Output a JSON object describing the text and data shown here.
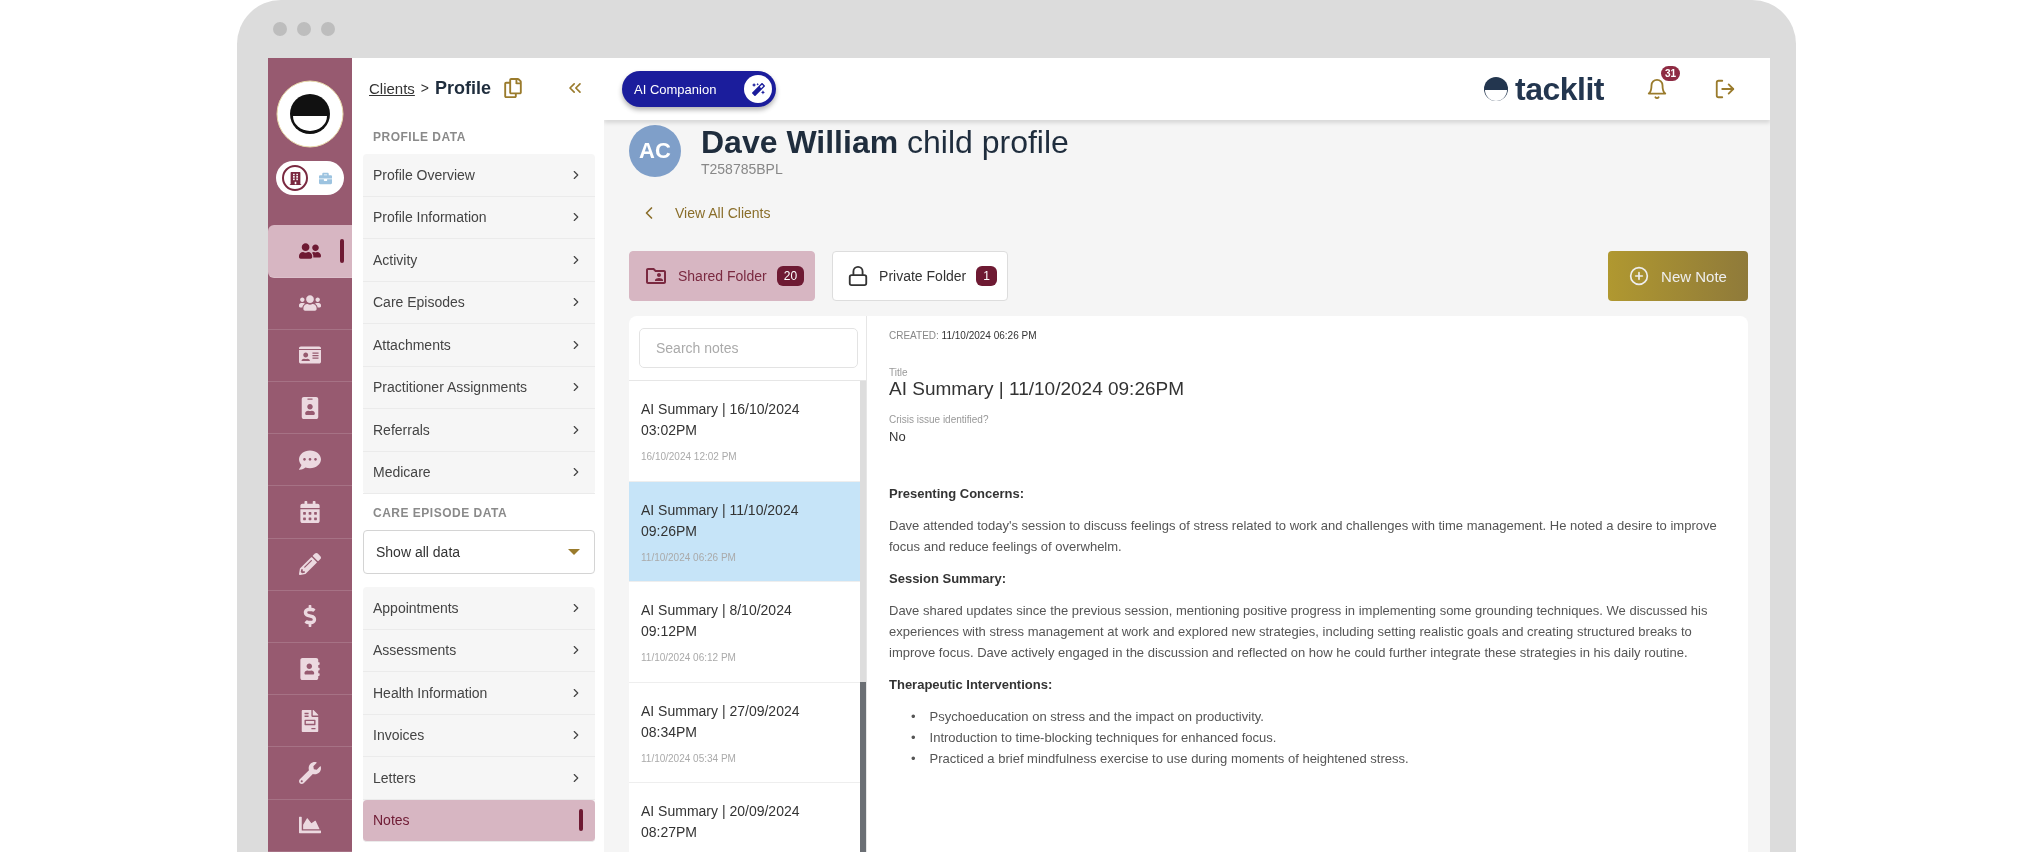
{
  "rail": {
    "items": [
      {
        "selected": true
      },
      {
        "selected": false
      },
      {
        "selected": false
      },
      {
        "selected": false
      },
      {
        "selected": false
      },
      {
        "selected": false
      },
      {
        "selected": false
      },
      {
        "selected": false
      },
      {
        "selected": false
      },
      {
        "selected": false
      },
      {
        "selected": false
      },
      {
        "selected": false
      }
    ],
    "mode_toggle": [
      {
        "selected": true
      },
      {
        "selected": false
      }
    ]
  },
  "sidebar": {
    "breadcrumb_link": "Clients",
    "breadcrumb_separator": ">",
    "breadcrumb_current": "Profile",
    "sections": [
      {
        "label": "PROFILE DATA",
        "items": [
          {
            "label": "Profile Overview",
            "selected": false
          },
          {
            "label": "Profile Information",
            "selected": false
          },
          {
            "label": "Activity",
            "selected": false
          },
          {
            "label": "Care Episodes",
            "selected": false
          },
          {
            "label": "Attachments",
            "selected": false
          },
          {
            "label": "Practitioner Assignments",
            "selected": false
          },
          {
            "label": "Referrals",
            "selected": false
          },
          {
            "label": "Medicare",
            "selected": false
          }
        ]
      },
      {
        "label": "CARE EPISODE DATA",
        "dropdown": "Show all data",
        "items": [
          {
            "label": "Appointments",
            "selected": false
          },
          {
            "label": "Assessments",
            "selected": false
          },
          {
            "label": "Health Information",
            "selected": false
          },
          {
            "label": "Invoices",
            "selected": false
          },
          {
            "label": "Letters",
            "selected": false
          },
          {
            "label": "Notes",
            "selected": true
          }
        ]
      }
    ]
  },
  "header": {
    "ai_button": "AI Companion",
    "brand": "tacklit",
    "notification_count": "31"
  },
  "profile": {
    "initials": "AC",
    "name": "**Dave William** child profile",
    "id": "T258785BPL",
    "back_link": "View All Clients"
  },
  "folders": [
    {
      "label": "Shared Folder",
      "count": "20",
      "selected": true
    },
    {
      "label": "Private Folder",
      "count": "1",
      "selected": false
    }
  ],
  "new_note_button": "New Note",
  "notes": {
    "search": {
      "placeholder": "Search notes"
    },
    "items": [
      {
        "title": "AI Summary | 16/10/2024 03:02PM",
        "date": "16/10/2024 12:02 PM",
        "selected": false
      },
      {
        "title": "AI Summary | 11/10/2024 09:26PM",
        "date": "11/10/2024 06:26 PM",
        "selected": true
      },
      {
        "title": "AI Summary | 8/10/2024 09:12PM",
        "date": "11/10/2024 06:12 PM",
        "selected": false
      },
      {
        "title": "AI Summary | 27/09/2024 08:34PM",
        "date": "11/10/2024 05:34 PM",
        "selected": false
      },
      {
        "title": "AI Summary | 20/09/2024 08:27PM",
        "selected": false
      }
    ]
  },
  "note": {
    "created_label": "CREATED:",
    "created_value": "11/10/2024 06:26 PM",
    "title_label": "Title",
    "title": "AI Summary | 11/10/2024 09:26PM",
    "crisis_label": "Crisis issue identified?",
    "crisis_value": "No",
    "body": [
      {
        "kind": "heading",
        "text": "Presenting Concerns:"
      },
      {
        "kind": "paragraph",
        "text": "Dave attended today's session to discuss feelings of stress related to work and challenges with time management. He noted a desire to improve focus and reduce feelings of overwhelm."
      },
      {
        "kind": "heading",
        "text": "Session Summary:"
      },
      {
        "kind": "paragraph",
        "text": "Dave shared updates since the previous session, mentioning positive progress in implementing some grounding techniques. We discussed his experiences with stress management at work and explored new strategies, including setting realistic goals and creating structured breaks to improve focus. Dave actively engaged in the discussion and reflected on how he could further integrate these strategies in his daily routine."
      },
      {
        "kind": "heading",
        "text": "Therapeutic Interventions:"
      },
      {
        "kind": "bullets",
        "marker": "•",
        "items": [
          "Psychoeducation on stress and the impact on productivity.",
          "Introduction to time-blocking techniques for enhanced focus.",
          "Practiced a brief mindfulness exercise to use during moments of heightened stress."
        ]
      }
    ]
  }
}
